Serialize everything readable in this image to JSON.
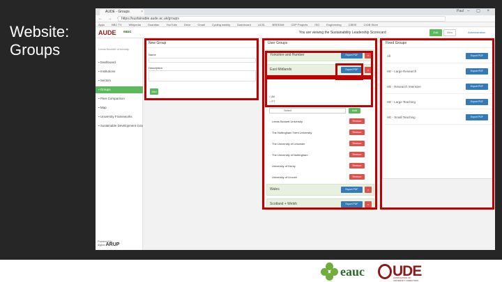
{
  "slide": {
    "title": "Website:\nGroups",
    "background": "#262626",
    "frame_color": "#c00000"
  },
  "footer": {
    "eauc_logo": "eauc",
    "aude_logo": "UDE",
    "aude_sub": "ASSOCIATION OF UNIVERSITY DIRECTORS OF ESTATES"
  },
  "browser": {
    "tab_title": "AUDE - Groups",
    "user": "Paul",
    "url": "https://sustainable.aude.ac.uk/groups",
    "bookmarks": [
      "Apps",
      "BBC TV",
      "Wikipedia",
      "Guardian",
      "YouTube",
      "Drive",
      "Gmail",
      "Cycling weekly",
      "Dashboard",
      "UCSL",
      "BREEAM",
      "CDP Projects",
      "ISO",
      "Engineering",
      "CIBSE",
      "CIOB Store"
    ]
  },
  "app": {
    "logo": "AUDE",
    "logo_partner": "eauc",
    "scorecard_text": "You are viewing the Sustainability Leadership Scorecard",
    "btn_primary": "Edit",
    "btn_secondary": "View",
    "admin_link": "Administration"
  },
  "sidebar": {
    "org": "Leeds Beckett University",
    "items": [
      {
        "label": "Dashboard",
        "active": false
      },
      {
        "label": "Institutions",
        "active": false
      },
      {
        "label": "Sectors",
        "active": false
      },
      {
        "label": "Groups",
        "active": true
      },
      {
        "label": "Peer Comparison",
        "active": false
      },
      {
        "label": "Map",
        "active": false
      },
      {
        "label": "University Frameworks",
        "active": false
      },
      {
        "label": "Sustainable Development Goals",
        "active": false
      }
    ],
    "footer_line1": "Powered by",
    "footer_line2": "digital",
    "footer_line3": "ARUP"
  },
  "new_group": {
    "title": "New Group",
    "name_label": "Name",
    "desc_label": "Description",
    "add_label": "Add"
  },
  "user_groups": {
    "title": "User Groups",
    "rows": [
      {
        "name": "Yorkshire and Humber"
      },
      {
        "name": "East Midlands"
      }
    ],
    "radios": [
      "All",
      "FT"
    ],
    "select_value": "Select",
    "select_add": "Add",
    "members": [
      "Leeds Beckett University",
      "The Nottingham Trent University",
      "The University of Leicester",
      "The University of Nottingham",
      "University of Derby",
      "University of Lincoln"
    ],
    "bottom_rows": [
      {
        "name": "Wales"
      },
      {
        "name": "Scotland + Welsh"
      }
    ],
    "export_label": "Export PDF",
    "delete_label": "Delete",
    "remove_label": "Remove"
  },
  "fixed_groups": {
    "title": "Fixed Groups",
    "rows": [
      "All",
      "HE - Large Research",
      "HE - Research Intensive",
      "HE - Large Teaching",
      "HE - Small Teaching"
    ],
    "export_label": "Export PDF"
  }
}
